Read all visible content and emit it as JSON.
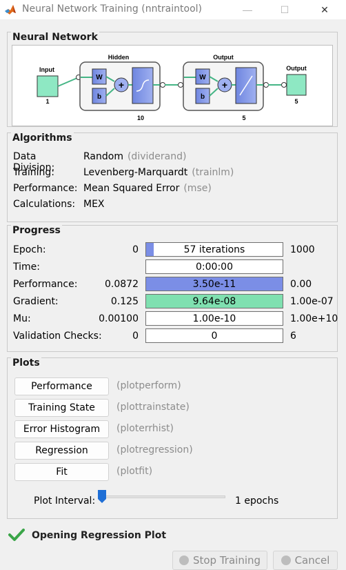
{
  "window": {
    "title": "Neural Network Training (nntraintool)",
    "minimize": "—",
    "maximize": "☐",
    "close": "✕"
  },
  "neural_network": {
    "title": "Neural Network",
    "input_label": "Input",
    "input_size": "1",
    "hidden_label": "Hidden",
    "hidden_size": "10",
    "output_layer_label": "Output",
    "output_layer_size": "5",
    "output_label": "Output",
    "output_size": "5",
    "w_label": "W",
    "b_label": "b",
    "plus_label": "+"
  },
  "algorithms": {
    "title": "Algorithms",
    "rows": [
      {
        "label": "Data Division:",
        "value": "Random",
        "fn": "(dividerand)"
      },
      {
        "label": "Training:",
        "value": "Levenberg-Marquardt",
        "fn": "(trainlm)"
      },
      {
        "label": "Performance:",
        "value": "Mean Squared Error",
        "fn": "(mse)"
      },
      {
        "label": "Calculations:",
        "value": "MEX",
        "fn": ""
      }
    ]
  },
  "progress": {
    "title": "Progress",
    "rows": [
      {
        "label": "Epoch:",
        "min": "0",
        "bar": "57 iterations",
        "max": "1000",
        "fill": 0.057,
        "color": "#7b8ee6"
      },
      {
        "label": "Time:",
        "min": "",
        "bar": "0:00:00",
        "max": "",
        "fill": 0,
        "color": "#7b8ee6"
      },
      {
        "label": "Performance:",
        "min": "0.0872",
        "bar": "3.50e-11",
        "max": "0.00",
        "fill": 1.0,
        "color": "#7b8ee6"
      },
      {
        "label": "Gradient:",
        "min": "0.125",
        "bar": "9.64e-08",
        "max": "1.00e-07",
        "fill": 1.0,
        "color": "#7fe0b0"
      },
      {
        "label": "Mu:",
        "min": "0.00100",
        "bar": "1.00e-10",
        "max": "1.00e+10",
        "fill": 0,
        "color": "#7b8ee6"
      },
      {
        "label": "Validation Checks:",
        "min": "0",
        "bar": "0",
        "max": "6",
        "fill": 0,
        "color": "#7b8ee6"
      }
    ]
  },
  "plots": {
    "title": "Plots",
    "buttons": [
      {
        "label": "Performance",
        "fn": "(plotperform)"
      },
      {
        "label": "Training State",
        "fn": "(plottrainstate)"
      },
      {
        "label": "Error Histogram",
        "fn": "(ploterrhist)"
      },
      {
        "label": "Regression",
        "fn": "(plotregression)"
      },
      {
        "label": "Fit",
        "fn": "(plotfit)"
      }
    ],
    "interval_label": "Plot Interval:",
    "interval_value": "1 epochs",
    "interval_fraction": 0.0
  },
  "status": {
    "text": "Opening Regression Plot",
    "icon": "check-icon"
  },
  "footer": {
    "stop_label": "Stop Training",
    "cancel_label": "Cancel"
  },
  "colors": {
    "accent_blue": "#7b8ee6",
    "accent_green": "#7fe0b0",
    "diagram_green": "#8ee8c3"
  }
}
